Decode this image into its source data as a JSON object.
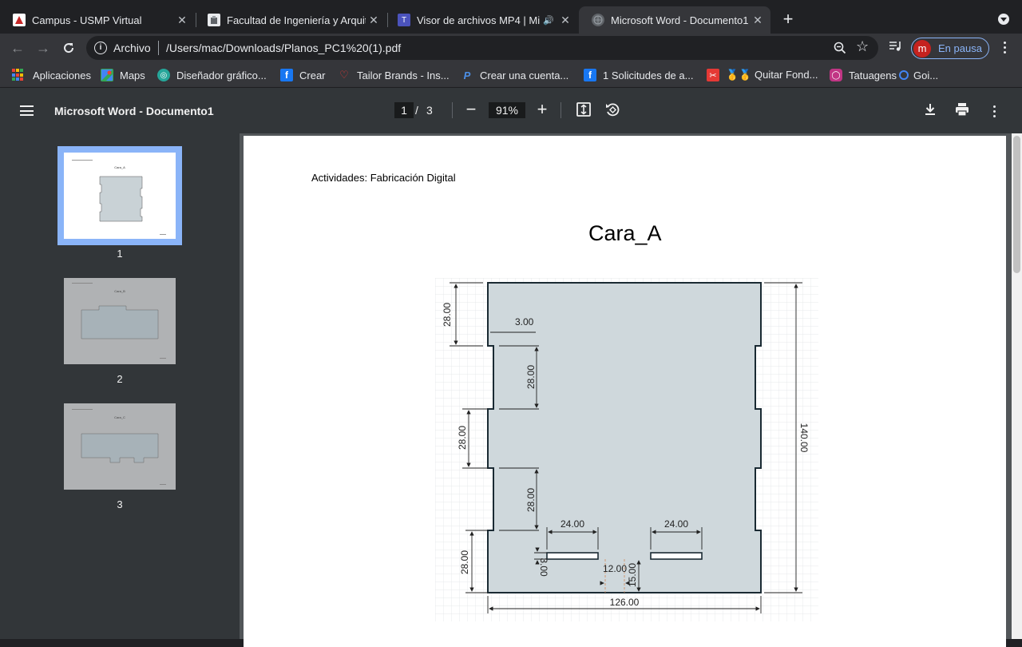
{
  "tabs": [
    {
      "title": "Campus - USMP Virtual",
      "favicon": "usmp-icon",
      "active": false
    },
    {
      "title": "Facultad de Ingeniería y Arquite",
      "favicon": "university-icon",
      "active": false
    },
    {
      "title": "Visor de archivos MP4 | Mi",
      "favicon": "teams-icon",
      "active": false,
      "audio": true
    },
    {
      "title": "Microsoft Word - Documento1",
      "favicon": "globe-icon",
      "active": true
    }
  ],
  "toolbar": {
    "scheme_label": "Archivo",
    "url": "/Users/mac/Downloads/Planos_PC1%20(1).pdf",
    "profile_initial": "m",
    "profile_label": "En pausa"
  },
  "bookmarks": [
    {
      "label": "Aplicaciones",
      "icon": "apps-grid-icon"
    },
    {
      "label": "Maps",
      "icon": "maps-icon"
    },
    {
      "label": "Diseñador gráfico...",
      "icon": "design-icon"
    },
    {
      "label": "Crear",
      "icon": "facebook-icon"
    },
    {
      "label": "Tailor Brands - Ins...",
      "icon": "tailor-brands-icon"
    },
    {
      "label": "Crear una cuenta...",
      "icon": "paypal-icon"
    },
    {
      "label": "1 Solicitudes de a...",
      "icon": "facebook-icon"
    },
    {
      "label": "🥇🥇 Quitar Fond...",
      "icon": "remove-bg-icon"
    },
    {
      "label": "Tatuagens",
      "icon": "instagram-icon"
    },
    {
      "label": "Goi...",
      "icon": "eye-icon"
    }
  ],
  "pdf": {
    "title": "Microsoft Word - Documento1",
    "current_page": "1",
    "separator": "/",
    "total_pages": "3",
    "zoom": "91%",
    "thumbnails": [
      {
        "label": "1",
        "heading": "Cara_A",
        "selected": true
      },
      {
        "label": "2",
        "heading": "Cara_B",
        "selected": false
      },
      {
        "label": "3",
        "heading": "Cara_C",
        "selected": false
      }
    ]
  },
  "document": {
    "header": "Actividades: Fabricación Digital",
    "heading": "Cara_A",
    "dimensions": {
      "top_tab": "28.00",
      "tab_depth": "3.00",
      "inner_tab_1": "28.00",
      "left_tab": "28.00",
      "inner_tab_2": "28.00",
      "bottom_tab": "28.00",
      "slot_left": "24.00",
      "slot_right": "24.00",
      "slot_height": "3.00",
      "center_gap": "12.00",
      "slot_offset": "15.00",
      "total_height": "140.00",
      "total_width": "126.00"
    }
  },
  "colors": {
    "accent": "#8ab4f8",
    "drawing_fill": "#cfd8dc",
    "drawing_stroke": "#1a2a33",
    "avatar": "#c5221f"
  }
}
